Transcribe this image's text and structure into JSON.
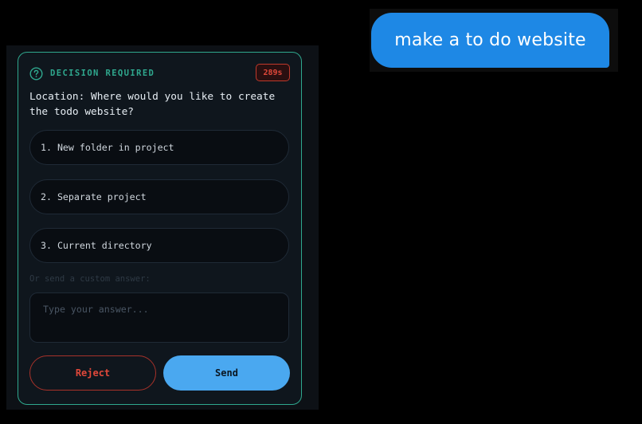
{
  "chat": {
    "user_message": "make a to do website"
  },
  "decision": {
    "title": "DECISION REQUIRED",
    "timer": "289s",
    "question": "Location: Where would you like to create the todo website?",
    "options": [
      {
        "label": "1. New folder in project"
      },
      {
        "label": "2. Separate project"
      },
      {
        "label": "3. Current directory"
      }
    ],
    "custom_label": "Or send a custom answer:",
    "answer_placeholder": "Type your answer...",
    "answer_value": "",
    "reject_label": "Reject",
    "send_label": "Send"
  },
  "icons": {
    "help": "help-circle-icon"
  },
  "colors": {
    "accent": "#2fa88e",
    "bubble": "#1e88e5",
    "danger": "#e0483a",
    "primary": "#4aa8f0"
  }
}
